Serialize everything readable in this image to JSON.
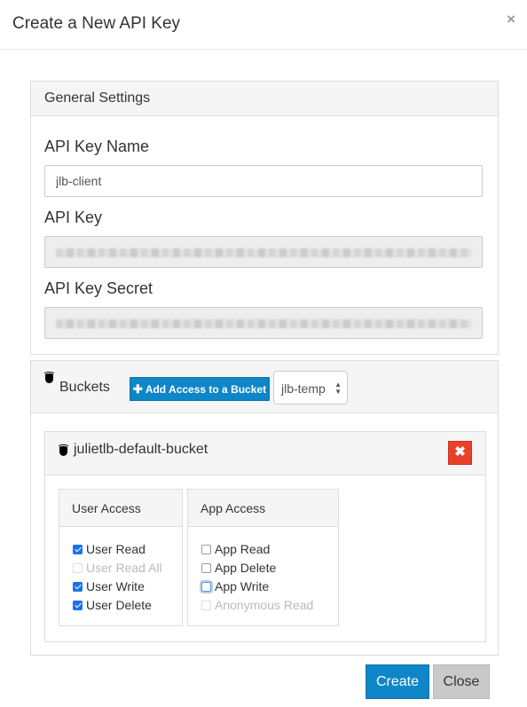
{
  "modal": {
    "title": "Create a New API Key",
    "close_glyph": "×",
    "close_icon": "close-icon"
  },
  "general": {
    "title": "General Settings",
    "name_label": "API Key Name",
    "name_value": "jlb-client",
    "key_label": "API Key",
    "secret_label": "API Key Secret"
  },
  "buckets": {
    "label": "Buckets",
    "icon": "bucket-icon",
    "add_button": {
      "icon": "plus-icon",
      "glyph": "✚",
      "label": "Add Access to a Bucket"
    },
    "select_value": "jlb-temp",
    "bucket_name": "julietlb-default-bucket",
    "remove_glyph": "✖",
    "user_access": {
      "title": "User Access",
      "items": [
        {
          "label": "User Read",
          "checked": true,
          "disabled": false
        },
        {
          "label": "User Read All",
          "checked": false,
          "disabled": true
        },
        {
          "label": "User Write",
          "checked": true,
          "disabled": false
        },
        {
          "label": "User Delete",
          "checked": true,
          "disabled": false
        }
      ]
    },
    "app_access": {
      "title": "App Access",
      "items": [
        {
          "label": "App Read",
          "checked": false,
          "disabled": false
        },
        {
          "label": "App Delete",
          "checked": false,
          "disabled": false
        },
        {
          "label": "App Write",
          "checked": false,
          "disabled": false,
          "focused": true
        },
        {
          "label": "Anonymous Read",
          "checked": false,
          "disabled": true
        }
      ]
    }
  },
  "footer": {
    "create_label": "Create",
    "close_label": "Close"
  },
  "colors": {
    "primary": "#0e86c7",
    "danger": "#e8412a",
    "secondary": "#c9c9c9",
    "checkbox": "#1a73e8"
  }
}
